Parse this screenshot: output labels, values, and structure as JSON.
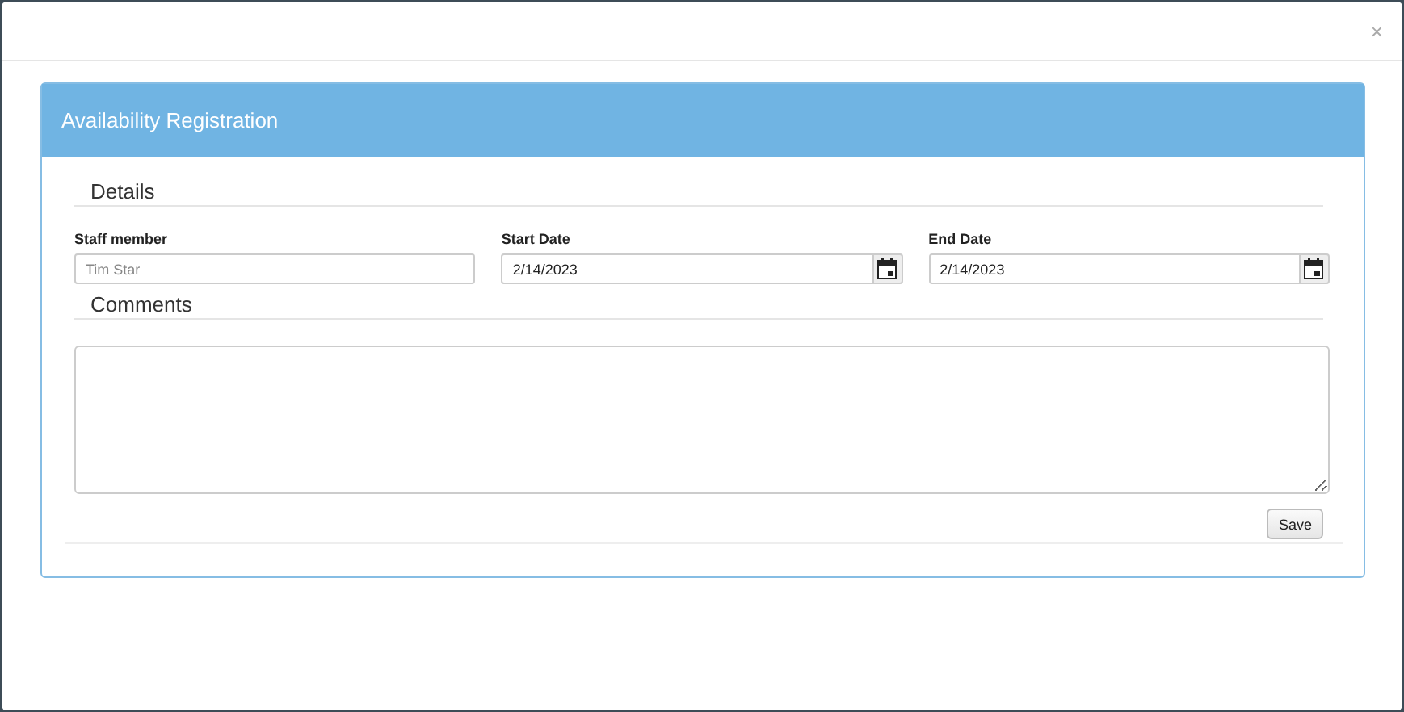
{
  "dialog": {
    "close": "×"
  },
  "panel": {
    "title": "Availability Registration"
  },
  "details": {
    "legend": "Details",
    "fields": [
      {
        "kind": "text",
        "label": "Staff member",
        "placeholder": "Tim Star"
      },
      {
        "kind": "date",
        "label": "Start Date",
        "value": "2/14/2023"
      },
      {
        "kind": "date",
        "label": "End Date",
        "value": "2/14/2023"
      }
    ]
  },
  "comments": {
    "legend": "Comments"
  },
  "buttons": [
    "Save"
  ]
}
